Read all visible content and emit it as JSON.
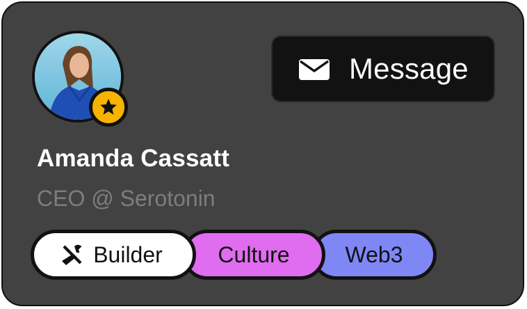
{
  "profile": {
    "name": "Amanda Cassatt",
    "title": "CEO @ Serotonin",
    "avatar_icon": "user-photo",
    "badge_icon": "star-icon"
  },
  "actions": {
    "message_label": "Message",
    "message_icon": "mail-icon"
  },
  "tags": [
    {
      "label": "Builder",
      "icon": "tools-icon",
      "color": "#ffffff"
    },
    {
      "label": "Culture",
      "color": "#e06cf0"
    },
    {
      "label": "Web3",
      "color": "#7f87f5"
    }
  ],
  "colors": {
    "card_bg": "#424242",
    "badge": "#f6b400",
    "button_bg": "#121212"
  }
}
